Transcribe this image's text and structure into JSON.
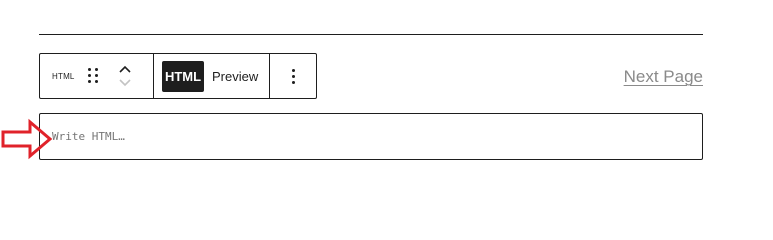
{
  "toolbar": {
    "block_type": "HTML",
    "html_label": "HTML",
    "preview_label": "Preview"
  },
  "pagination": {
    "next_label": "Next Page"
  },
  "editor": {
    "placeholder": "Write HTML…"
  },
  "colors": {
    "text": "#1e1e1e",
    "muted": "#8a8a8a",
    "arrow": "#e0222a"
  },
  "icons": [
    "drag-handle-icon",
    "chevron-up-icon",
    "chevron-down-icon",
    "more-vertical-icon",
    "arrow-right-icon"
  ]
}
